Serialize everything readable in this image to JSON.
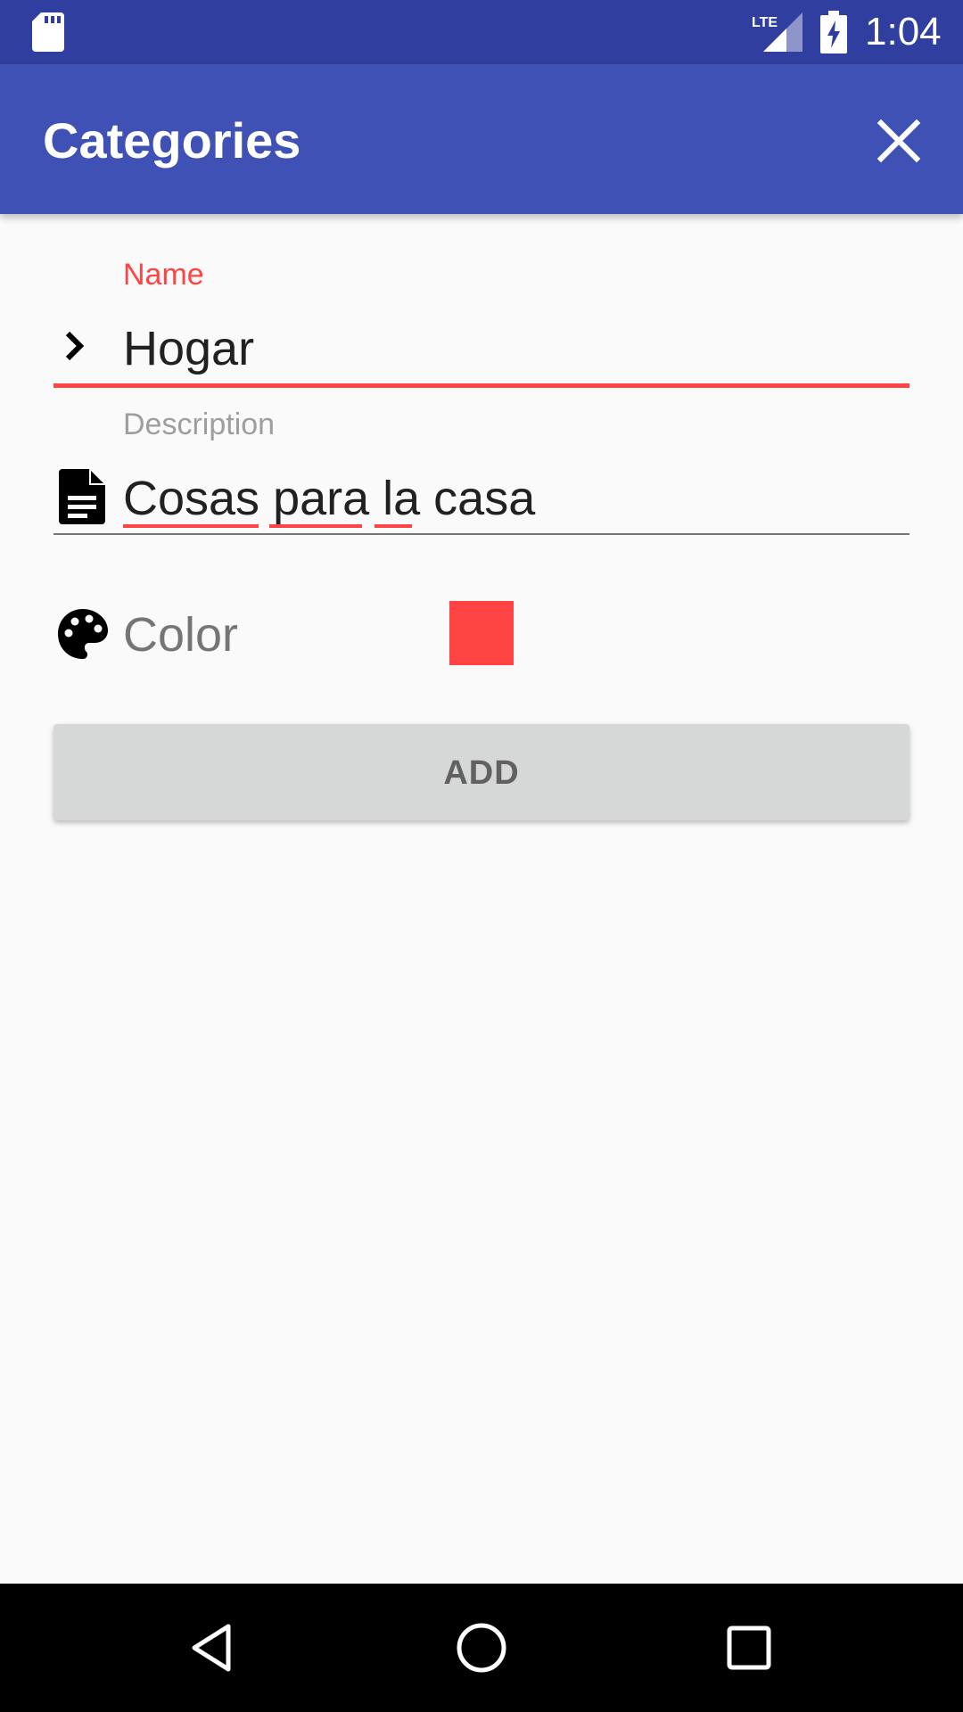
{
  "status_bar": {
    "time": "1:04",
    "icons": [
      "sd-card-icon",
      "lte-signal-icon",
      "battery-charging-icon"
    ],
    "network_label": "LTE"
  },
  "app_bar": {
    "title": "Categories",
    "close_icon": "close-icon"
  },
  "form": {
    "name": {
      "label": "Name",
      "value": "Hogar",
      "icon": "chevron-right-icon"
    },
    "description": {
      "label": "Description",
      "value": "Cosas para la casa",
      "icon": "document-icon"
    },
    "color": {
      "label": "Color",
      "icon": "palette-icon",
      "value": "#ff4444"
    },
    "add_button_label": "ADD"
  },
  "nav_bar": {
    "icons": [
      "back-icon",
      "home-icon",
      "recents-icon"
    ]
  },
  "colors": {
    "status_bar": "#303f9f",
    "app_bar": "#3f51b5",
    "accent": "#ff4444",
    "button_bg": "#d6d7d7",
    "background": "#fafafa"
  }
}
